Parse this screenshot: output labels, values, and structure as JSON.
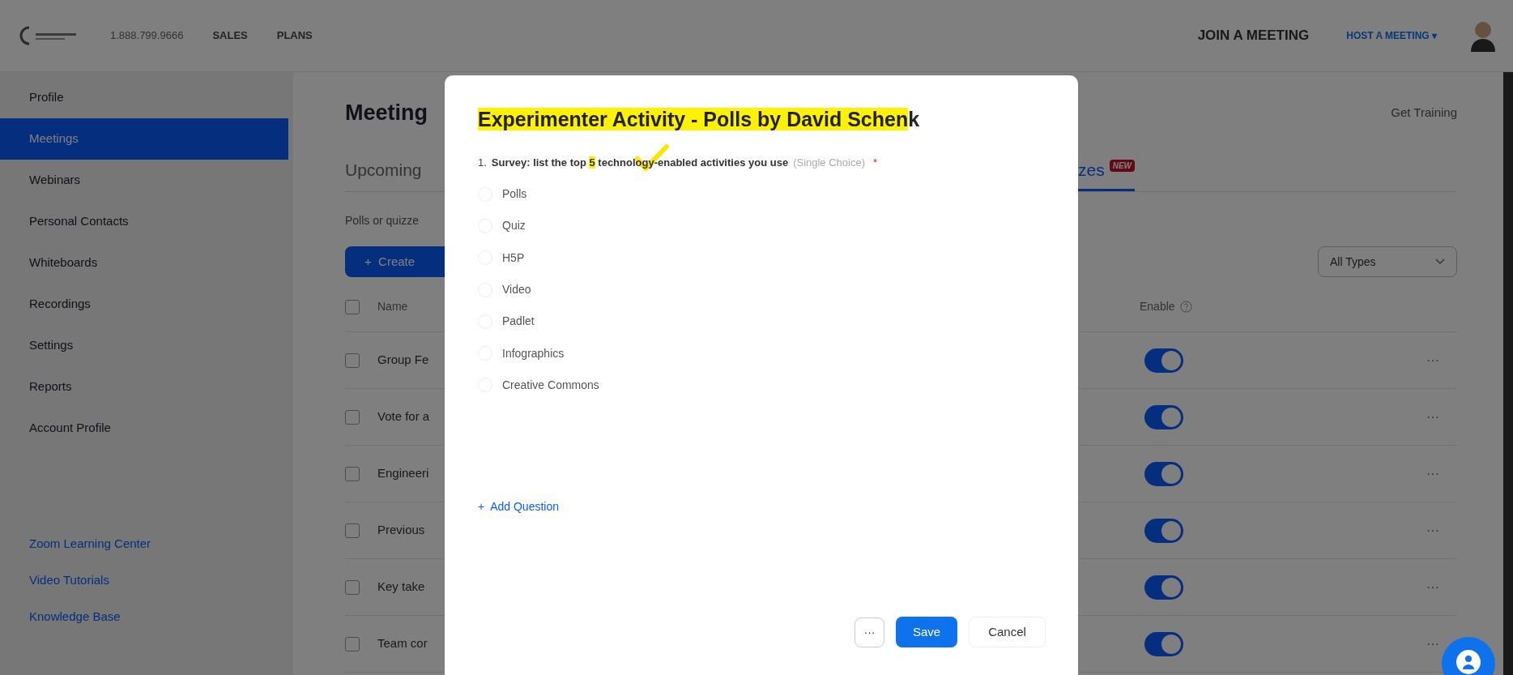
{
  "top_bar": {
    "phone": "1.888.799.9666",
    "links": [
      "SALES",
      "PLANS"
    ],
    "join": "JOIN A MEETING",
    "host": "HOST A MEETING ▾"
  },
  "sidebar": {
    "items": [
      {
        "label": "Profile",
        "selected": false
      },
      {
        "label": "Meetings",
        "selected": true
      },
      {
        "label": "Webinars",
        "selected": false
      },
      {
        "label": "Personal Contacts",
        "selected": false
      },
      {
        "label": "Whiteboards",
        "selected": false
      },
      {
        "label": "Recordings",
        "selected": false
      },
      {
        "label": "Settings",
        "selected": false
      },
      {
        "label": "Reports",
        "selected": false
      },
      {
        "label": "Account Profile",
        "selected": false
      }
    ],
    "links": [
      "Zoom Learning Center",
      "Video Tutorials",
      "Knowledge Base"
    ]
  },
  "main": {
    "title": "Meeting",
    "get_training": "Get Training",
    "tabs": [
      {
        "label": "Upcoming",
        "selected": false
      },
      {
        "label": "zes",
        "badge": "NEW",
        "selected": true
      }
    ],
    "description": "Polls or quizze",
    "create": "+  Create",
    "filter": "All Types",
    "table": {
      "columns": [
        "Name",
        "Enable"
      ],
      "all_checked": false,
      "rows": [
        {
          "name": "Group Fe",
          "checked": false,
          "on": true,
          "menu": "···"
        },
        {
          "name": "Vote for a",
          "checked": false,
          "on": true,
          "menu": "···"
        },
        {
          "name": "Engineeri",
          "checked": false,
          "on": true,
          "menu": "···"
        },
        {
          "name": "Previous",
          "checked": false,
          "on": true,
          "menu": "···"
        },
        {
          "name": "Key take",
          "checked": false,
          "on": true,
          "menu": "···"
        },
        {
          "name": "Team cor",
          "checked": false,
          "on": true,
          "menu": "···"
        }
      ]
    }
  },
  "dialog": {
    "title_highlighted": "Experimenter Activity - Polls by David Schen",
    "title_rest": "k",
    "question": {
      "number": "1.",
      "before": "Survey: list the top ",
      "highlighted": "5",
      "after": " technology-enabled activities you use",
      "hint": "(Single Choice)",
      "required": "*"
    },
    "options": [
      {
        "label": "Polls",
        "selected": false
      },
      {
        "label": "Quiz",
        "selected": false
      },
      {
        "label": "H5P",
        "selected": false
      },
      {
        "label": "Video",
        "selected": false
      },
      {
        "label": "Padlet",
        "selected": false
      },
      {
        "label": "Infographics",
        "selected": false
      },
      {
        "label": "Creative Commons",
        "selected": false
      }
    ],
    "add_question": "+  Add Question",
    "more": "···",
    "save": "Save",
    "cancel": "Cancel"
  }
}
